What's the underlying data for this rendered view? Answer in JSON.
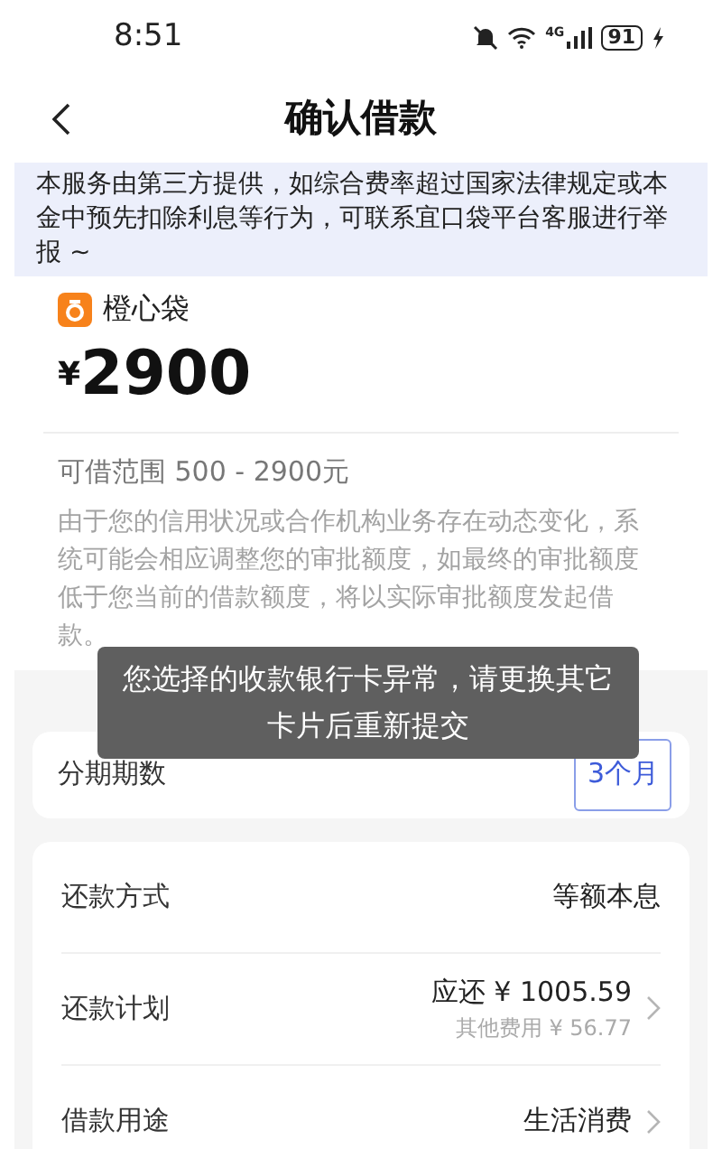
{
  "status_bar": {
    "time": "8:51",
    "network": "4G",
    "battery": "91"
  },
  "header": {
    "title": "确认借款"
  },
  "notice": "本服务由第三方提供，如综合费率超过国家法律规定或本金中预先扣除利息等行为，可联系宜口袋平台客服进行举报 ~",
  "loan": {
    "brand": "橙心袋",
    "currency": "¥",
    "amount": "2900",
    "range": "可借范围 500 - 2900元",
    "description": "由于您的信用状况或合作机构业务存在动态变化，系统可能会相应调整您的审批额度，如最终的审批额度低于您当前的借款额度，将以实际审批额度发起借款。"
  },
  "installments": {
    "label": "分期期数",
    "value": "3个月"
  },
  "details": [
    {
      "label": "还款方式",
      "value": "等额本息",
      "chevron": false
    },
    {
      "label": "还款计划",
      "value": "应还 ¥ 1005.59",
      "note": "其他费用 ¥ 56.77",
      "chevron": true
    },
    {
      "label": "借款用途",
      "value": "生活消费",
      "chevron": true
    }
  ],
  "toast": "您选择的收款银行卡异常，请更换其它卡片后重新提交"
}
